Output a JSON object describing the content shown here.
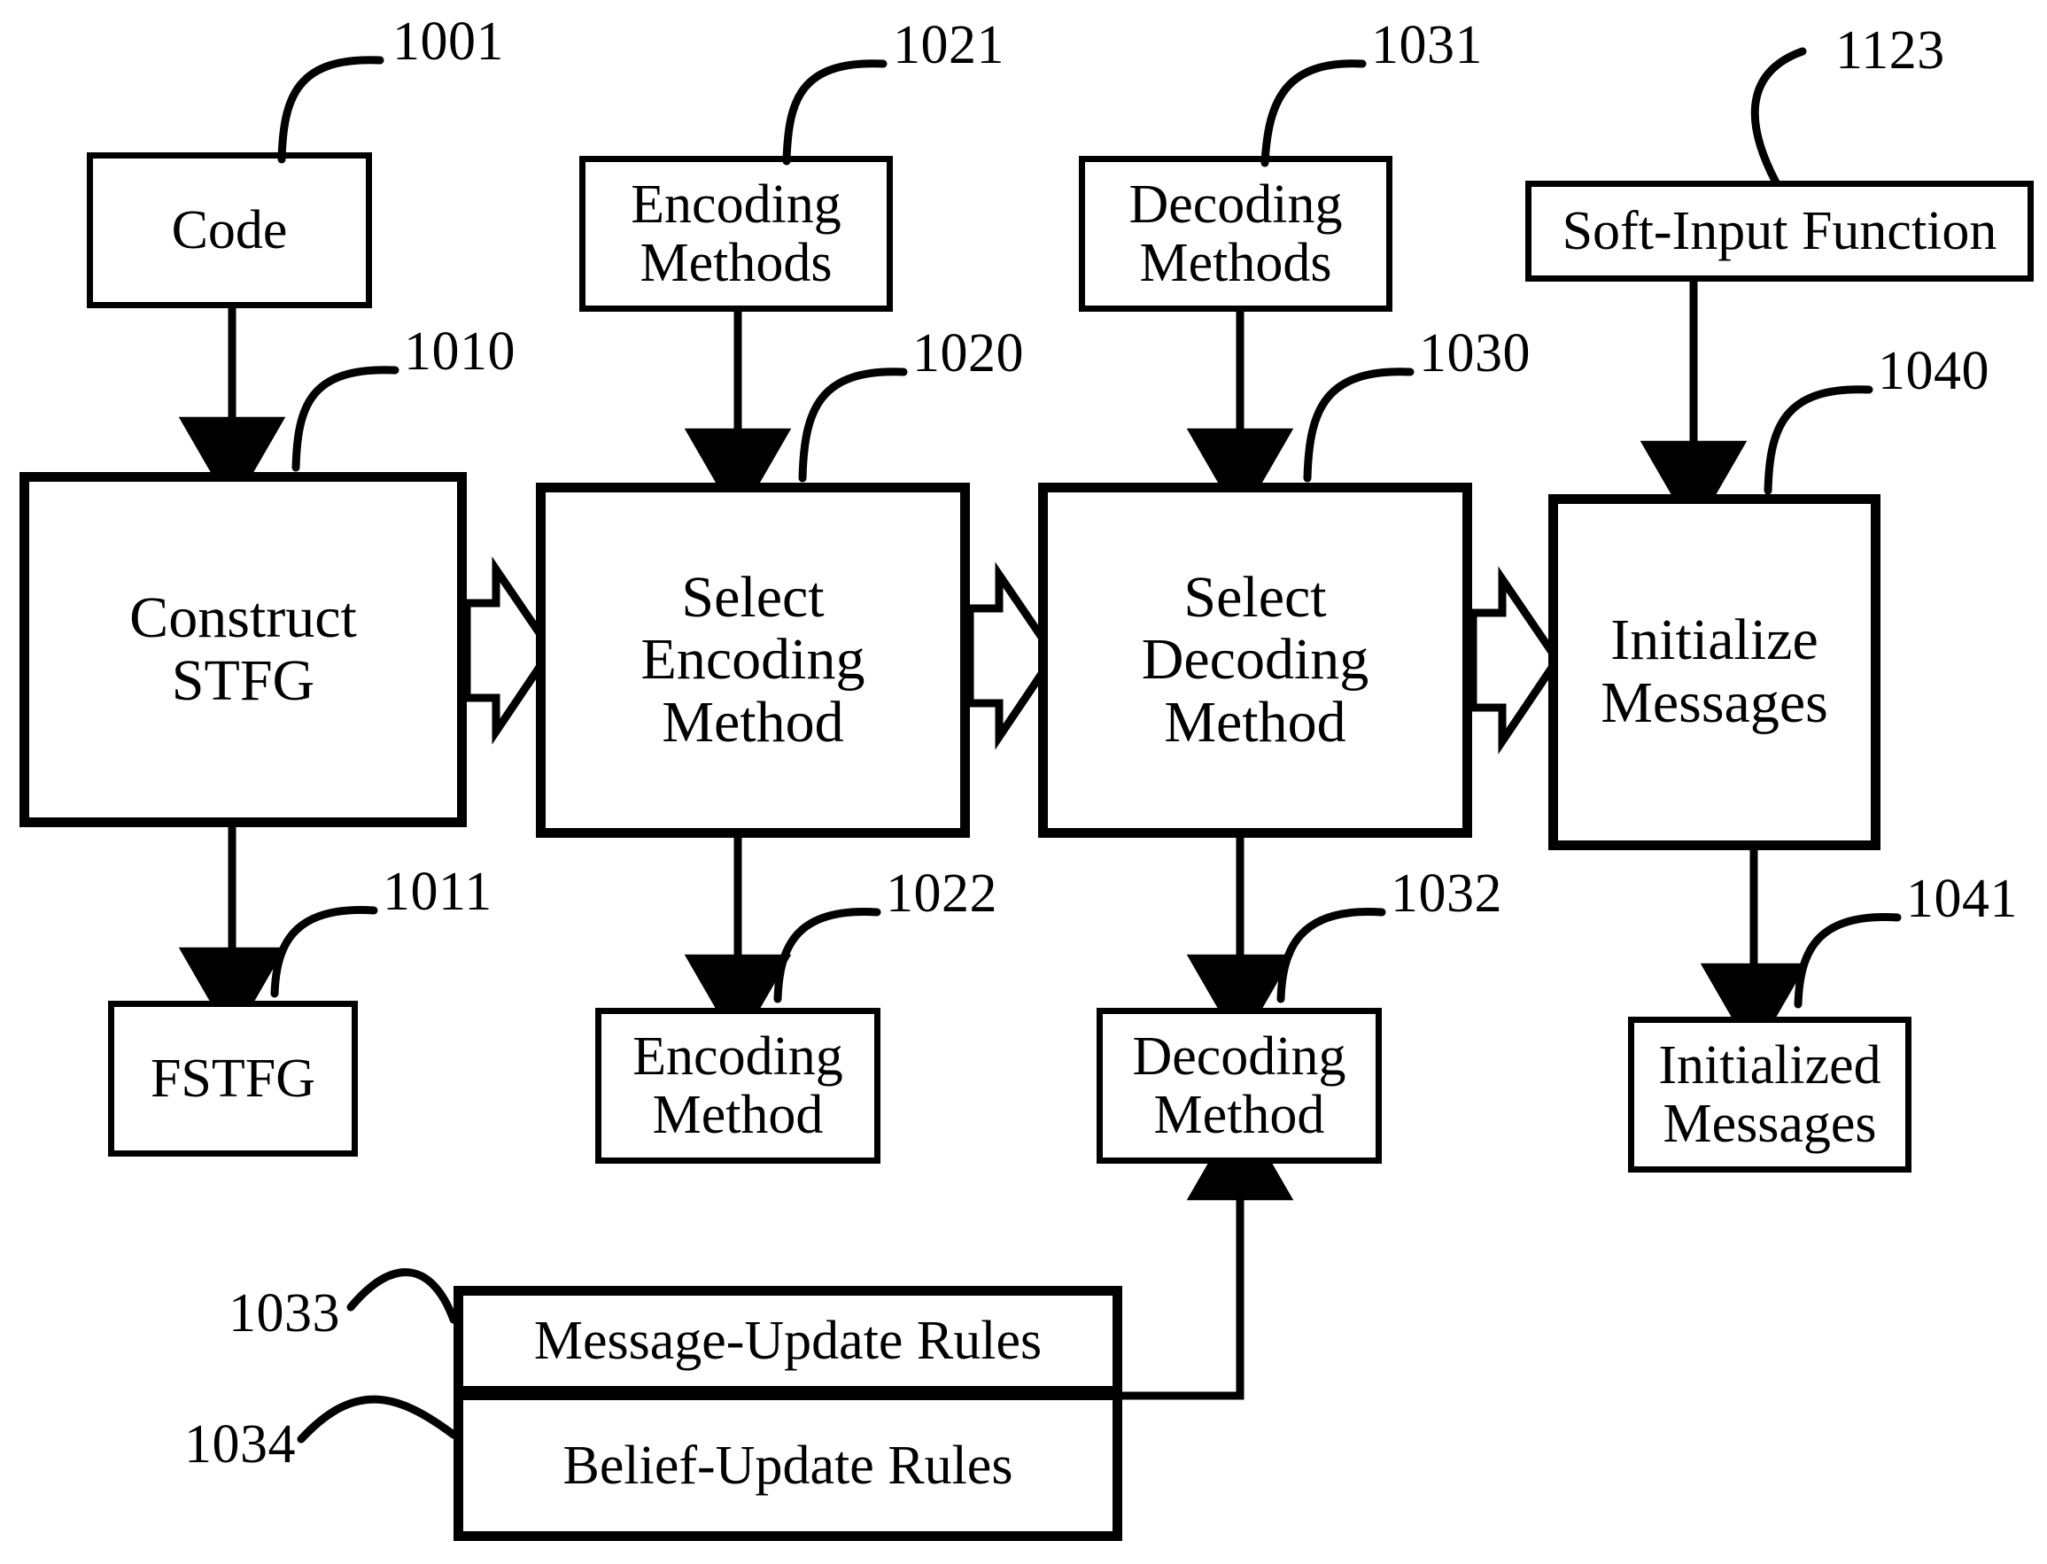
{
  "figure": {
    "kind": "patent-flowchart",
    "line_color": "#000000",
    "background_color": "#ffffff"
  },
  "input_boxes": [
    {
      "id": "code",
      "label": "Code",
      "ref": "1001"
    },
    {
      "id": "encoding-methods",
      "label": "Encoding\nMethods",
      "ref": "1021"
    },
    {
      "id": "decoding-methods",
      "label": "Decoding\nMethods",
      "ref": "1031"
    },
    {
      "id": "soft-input",
      "label": "Soft-Input Function",
      "ref": "1123"
    }
  ],
  "process_boxes": [
    {
      "id": "construct-stfg",
      "label": "Construct\nSTFG",
      "ref": "1010"
    },
    {
      "id": "select-encoding",
      "label": "Select\nEncoding\nMethod",
      "ref": "1020"
    },
    {
      "id": "select-decoding",
      "label": "Select\nDecoding\nMethod",
      "ref": "1030"
    },
    {
      "id": "initialize-msgs",
      "label": "Initialize\nMessages",
      "ref": "1040"
    }
  ],
  "output_boxes": [
    {
      "id": "fstfg",
      "label": "FSTFG",
      "ref": "1011"
    },
    {
      "id": "encoding-method",
      "label": "Encoding\nMethod",
      "ref": "1022"
    },
    {
      "id": "decoding-method",
      "label": "Decoding\nMethod",
      "ref": "1032"
    },
    {
      "id": "initialized-messages",
      "label": "Initialized\nMessages",
      "ref": "1041"
    }
  ],
  "rules_boxes": [
    {
      "id": "message-update-rules",
      "label": "Message-Update Rules",
      "ref": "1033"
    },
    {
      "id": "belief-update-rules",
      "label": "Belief-Update Rules",
      "ref": "1034"
    }
  ],
  "connectors": {
    "block_arrows": [
      {
        "from": "construct-stfg",
        "to": "select-encoding",
        "style": "hollow-block-arrow"
      },
      {
        "from": "select-encoding",
        "to": "select-decoding",
        "style": "hollow-block-arrow"
      },
      {
        "from": "select-decoding",
        "to": "initialize-msgs",
        "style": "hollow-block-arrow"
      }
    ],
    "line_arrows": [
      {
        "from": "code",
        "to": "construct-stfg",
        "style": "solid-arrow-down"
      },
      {
        "from": "encoding-methods",
        "to": "select-encoding",
        "style": "solid-arrow-down"
      },
      {
        "from": "decoding-methods",
        "to": "select-decoding",
        "style": "solid-arrow-down"
      },
      {
        "from": "soft-input",
        "to": "initialize-msgs",
        "style": "solid-arrow-down"
      },
      {
        "from": "construct-stfg",
        "to": "fstfg",
        "style": "solid-arrow-down"
      },
      {
        "from": "select-encoding",
        "to": "encoding-method",
        "style": "solid-arrow-down"
      },
      {
        "from": "select-decoding",
        "to": "decoding-method",
        "style": "solid-arrow-down"
      },
      {
        "from": "initialize-msgs",
        "to": "initialized-messages",
        "style": "solid-arrow-down"
      },
      {
        "from": "message-update-rules",
        "to": "decoding-method",
        "style": "routed-arrow-up"
      }
    ]
  }
}
